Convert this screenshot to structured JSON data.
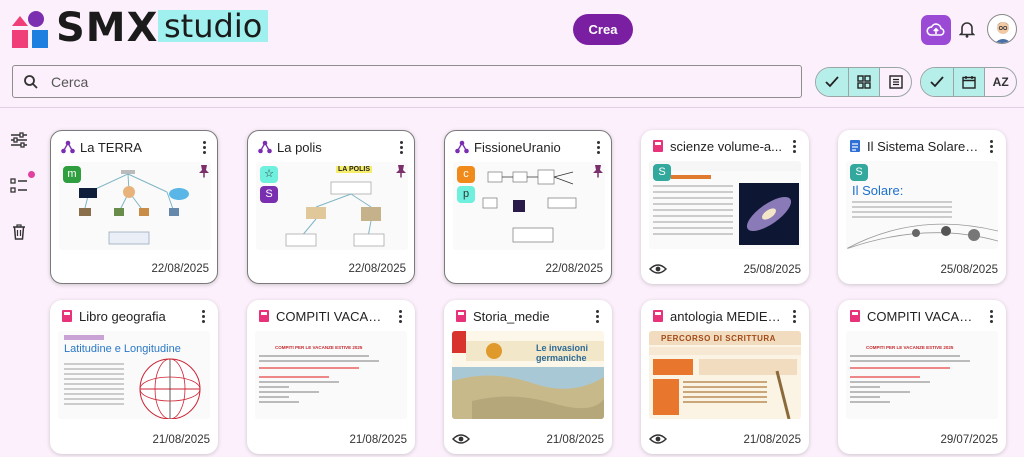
{
  "app": {
    "brand_main": "SMX",
    "brand_sub": "studio"
  },
  "header": {
    "create_label": "Crea"
  },
  "search": {
    "placeholder": "Cerca"
  },
  "view_toggles": {
    "sort_label": "AZ"
  },
  "colors": {
    "accent": "#7b1fa2",
    "background": "#fbf0fb",
    "toggle_on": "#b6eeea",
    "brand_highlight": "#9ff0ee"
  },
  "cards": [
    {
      "title": "La TERRA",
      "date": "22/08/2025",
      "type": "map",
      "badges": [
        "m"
      ]
    },
    {
      "title": "La polis",
      "date": "22/08/2025",
      "type": "map",
      "badges": [
        "☆",
        "S"
      ],
      "thumb_text": "LA POLIS"
    },
    {
      "title": "FissioneUranio",
      "date": "22/08/2025",
      "type": "map",
      "badges": [
        "c",
        "p"
      ]
    },
    {
      "title": "scienze volume-a...",
      "date": "25/08/2025",
      "type": "book",
      "badges": [
        "S"
      ]
    },
    {
      "title": "Il Sistema Solare ...",
      "date": "25/08/2025",
      "type": "doc",
      "badges": [
        "S"
      ],
      "thumb_text": "Il Solare:"
    },
    {
      "title": "Libro geografia",
      "date": "21/08/2025",
      "type": "book",
      "badges": [],
      "thumb_text": "Latitudine e Longitudine"
    },
    {
      "title": "COMPITI VACAN...",
      "date": "21/08/2025",
      "type": "book",
      "badges": [],
      "thumb_text": "COMPITI PER LE VACANZE ESTIVE 2025"
    },
    {
      "title": "Storia_medie",
      "date": "21/08/2025",
      "type": "book",
      "badges": [],
      "thumb_text": "Le invasioni germaniche"
    },
    {
      "title": "antologia MEDIEe...",
      "date": "21/08/2025",
      "type": "book",
      "badges": [],
      "thumb_text": "PERCORSO DI SCRITTURA"
    },
    {
      "title": "COMPITI VACAN...",
      "date": "29/07/2025",
      "type": "book",
      "badges": [],
      "thumb_text": "COMPITI PER LE VACANZE ESTIVE 2025"
    }
  ]
}
